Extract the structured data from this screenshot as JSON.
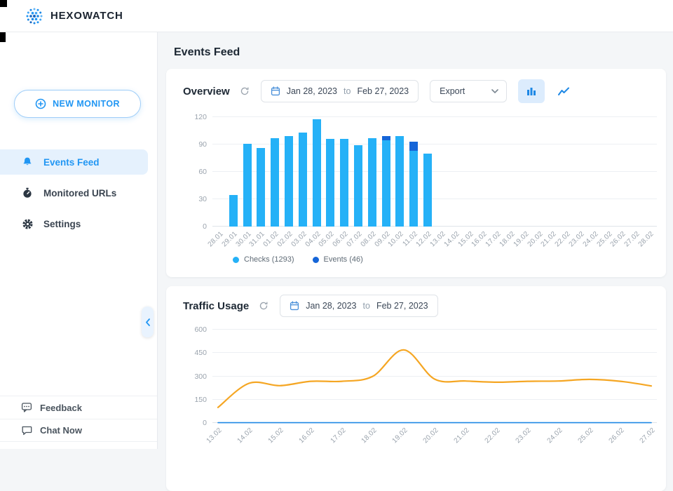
{
  "header": {
    "brand": "HEXOWATCH"
  },
  "sidebar": {
    "new_monitor_label": "NEW MONITOR",
    "items": [
      {
        "label": "Events Feed",
        "active": true
      },
      {
        "label": "Monitored URLs",
        "active": false
      },
      {
        "label": "Settings",
        "active": false
      }
    ],
    "footer_items": [
      {
        "label": "Feedback"
      },
      {
        "label": "Chat Now"
      }
    ]
  },
  "page": {
    "title": "Events Feed"
  },
  "overview_card": {
    "title": "Overview",
    "date_range": {
      "start": "Jan 28, 2023",
      "separator": "to",
      "end": "Feb 27, 2023"
    },
    "export_label": "Export",
    "legend": [
      {
        "label": "Checks (1293)",
        "color": "#25b1f7"
      },
      {
        "label": "Events (46)",
        "color": "#1565d8"
      }
    ]
  },
  "traffic_card": {
    "title": "Traffic Usage",
    "date_range": {
      "start": "Jan 28, 2023",
      "separator": "to",
      "end": "Feb 27, 2023"
    }
  },
  "colors": {
    "accent": "#2196f3",
    "checks_bar": "#25b1f7",
    "events_bar": "#1565d8",
    "traffic_line": "#f5a623",
    "baseline_line": "#1e88e5"
  },
  "chart_data": [
    {
      "type": "bar",
      "title": "Overview",
      "stacked": true,
      "categories": [
        "28.01",
        "29.01",
        "30.01",
        "31.01",
        "01.02",
        "02.02",
        "03.02",
        "04.02",
        "05.02",
        "06.02",
        "07.02",
        "08.02",
        "09.02",
        "10.02",
        "11.02",
        "12.02",
        "13.02",
        "14.02",
        "15.02",
        "16.02",
        "17.02",
        "18.02",
        "19.02",
        "20.02",
        "21.02",
        "22.02",
        "23.02",
        "24.02",
        "25.02",
        "26.02",
        "27.02",
        "28.02"
      ],
      "series": [
        {
          "name": "Checks (1293)",
          "color": "#25b1f7",
          "values": [
            0,
            35,
            91,
            86,
            97,
            99,
            103,
            118,
            96,
            96,
            89,
            97,
            95,
            99,
            83,
            80,
            0,
            0,
            0,
            0,
            0,
            0,
            0,
            0,
            0,
            0,
            0,
            0,
            0,
            0,
            0,
            0
          ]
        },
        {
          "name": "Events (46)",
          "color": "#1565d8",
          "values": [
            0,
            0,
            0,
            0,
            0,
            0,
            0,
            0,
            0,
            0,
            0,
            0,
            4,
            0,
            10,
            0,
            0,
            0,
            0,
            0,
            0,
            0,
            0,
            0,
            0,
            0,
            0,
            0,
            0,
            0,
            0,
            0
          ]
        }
      ],
      "xlabel": "",
      "ylabel": "",
      "ylim": [
        0,
        120
      ],
      "yticks": [
        0,
        30,
        60,
        90,
        120
      ],
      "grid": true,
      "legend_position": "bottom"
    },
    {
      "type": "line",
      "title": "Traffic Usage",
      "categories": [
        "13.02",
        "14.02",
        "15.02",
        "16.02",
        "17.02",
        "18.02",
        "19.02",
        "20.02",
        "21.02",
        "22.02",
        "23.02",
        "24.02",
        "25.02",
        "26.02",
        "27.02"
      ],
      "series": [
        {
          "name": "Traffic",
          "color": "#f5a623",
          "values": [
            100,
            255,
            240,
            268,
            268,
            300,
            470,
            282,
            270,
            262,
            268,
            270,
            280,
            268,
            238
          ]
        },
        {
          "name": "Baseline",
          "color": "#1e88e5",
          "values": [
            2,
            2,
            2,
            2,
            2,
            2,
            2,
            2,
            2,
            2,
            2,
            2,
            2,
            2,
            2
          ]
        }
      ],
      "xlabel": "",
      "ylabel": "",
      "ylim": [
        0,
        600
      ],
      "yticks": [
        0,
        150,
        300,
        450,
        600
      ],
      "grid": true
    }
  ]
}
